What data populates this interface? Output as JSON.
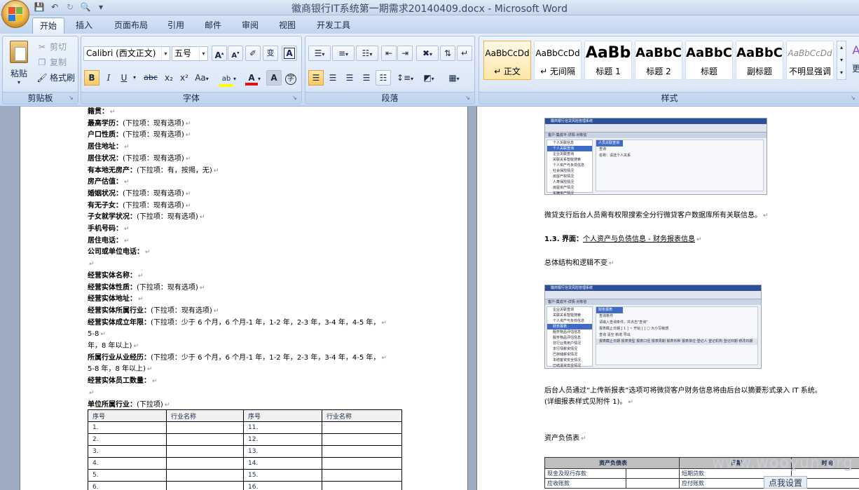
{
  "window": {
    "title": "徽商银行IT系统第一期需求20140409.docx - Microsoft Word"
  },
  "quick_access": [
    "save-icon",
    "undo-icon",
    "redo-icon",
    "print-preview-icon",
    "customize-icon"
  ],
  "tabs": [
    "开始",
    "插入",
    "页面布局",
    "引用",
    "邮件",
    "审阅",
    "视图",
    "开发工具"
  ],
  "ribbon": {
    "clipboard": {
      "label": "剪贴板",
      "paste": "粘贴",
      "cut": "剪切",
      "copy": "复制",
      "format_painter": "格式刷"
    },
    "font": {
      "label": "字体",
      "font_name": "Calibri (西文正文)",
      "font_size": "五号",
      "phonetic": "变",
      "buttons": [
        "B",
        "I",
        "U",
        "abc",
        "x₂",
        "x²",
        "Aa"
      ]
    },
    "paragraph": {
      "label": "段落"
    },
    "styles": {
      "label": "样式",
      "change_styles": "更",
      "items": [
        {
          "sample": "AaBbCcDd",
          "name": "↵ 正文"
        },
        {
          "sample": "AaBbCcDd",
          "name": "↵ 无间隔"
        },
        {
          "sample": "AaBb",
          "name": "标题 1"
        },
        {
          "sample": "AaBbC",
          "name": "标题 2"
        },
        {
          "sample": "AaBbC",
          "name": "标题"
        },
        {
          "sample": "AaBbC",
          "name": "副标题"
        },
        {
          "sample": "AaBbCcDd",
          "name": "不明显强调"
        }
      ]
    }
  },
  "left_page": {
    "lines": [
      {
        "bold": "籍贯：",
        "rest": ""
      },
      {
        "bold": "最高学历：",
        "rest": "(下拉项：现有选项)"
      },
      {
        "bold": "户口性质：",
        "rest": "(下拉项：现有选项)"
      },
      {
        "bold": "居住地址：",
        "rest": ""
      },
      {
        "bold": "居住状况：",
        "rest": "(下拉项：现有选项)"
      },
      {
        "bold": "有本地无房产：",
        "rest": "(下拉项：有，按揭，无)"
      },
      {
        "bold": "房产估值：",
        "rest": ""
      },
      {
        "bold": "婚姻状况：",
        "rest": "(下拉项：现有选项)"
      },
      {
        "bold": "有无子女：",
        "rest": "(下拉项：现有选项)"
      },
      {
        "bold": "子女就学状况：",
        "rest": "(下拉项：现有选项)"
      },
      {
        "bold": "手机号码：",
        "rest": ""
      },
      {
        "bold": "居住电话：",
        "rest": ""
      },
      {
        "bold": "公司或单位电话：",
        "rest": ""
      },
      {
        "bold": "",
        "rest": ""
      },
      {
        "bold": "经营实体名称：",
        "rest": ""
      },
      {
        "bold": "经营实体性质：",
        "rest": "(下拉项：现有选项)"
      },
      {
        "bold": "经营实体地址：",
        "rest": ""
      },
      {
        "bold": "经营实体所属行业：",
        "rest": "(下拉项：现有选项)"
      },
      {
        "bold": "经营实体成立年限：",
        "rest": "(下拉项：少于 6 个月，6 个月-1 年，1-2 年，2-3 年，3-4 年，4-5 年，"
      },
      {
        "bold": "",
        "rest": "5-8"
      },
      {
        "bold": "",
        "rest": "年，8 年以上)"
      },
      {
        "bold": "所属行业从业经历：",
        "rest": "(下拉项：少于 6 个月，6 个月-1 年，1-2 年，2-3 年，3-4 年，4-5 年，"
      },
      {
        "bold": "",
        "rest": "5-8 年，8 年以上)"
      },
      {
        "bold": "经营实体员工数量：",
        "rest": ""
      },
      {
        "bold": "",
        "rest": ""
      },
      {
        "bold": "单位所属行业：",
        "rest": "(下拉项)"
      }
    ],
    "table": {
      "headers": [
        "序号",
        "行业名称",
        "序号",
        "行业名称"
      ],
      "rows": [
        [
          "1.",
          "",
          "11.",
          ""
        ],
        [
          "2.",
          "",
          "12.",
          ""
        ],
        [
          "3.",
          "",
          "13.",
          ""
        ],
        [
          "4.",
          "",
          "14.",
          ""
        ],
        [
          "5.",
          "",
          "15.",
          ""
        ],
        [
          "6.",
          "",
          "16.",
          ""
        ]
      ]
    }
  },
  "right_page": {
    "screenshot1": {
      "title": "徽商银行信贷风险管理系统",
      "crumb": "客户-集成平-详情-对象信",
      "tree": [
        "个人关联信息",
        "个人关联查询",
        "企业关联查询",
        "关联关系智能搜索",
        "个人资产与负债信息",
        "社会保险情况",
        "房屋产权情况",
        "人寿保险情况",
        "房屋资产情况",
        "车辆资产情况"
      ],
      "main_head": "人员关联查询",
      "main_rows": [
        "查询",
        "名称：请选个人关系"
      ]
    },
    "para1": "微贷支行后台人员需有权限搜索全分行微贷客户数据库所有关联信息。",
    "heading": "1.3.  界面：",
    "heading_link": "个人资产与负债信息 - 财务报表信息",
    "para2": "总体结构和逻辑不变",
    "screenshot2": {
      "title": "徽商银行信贷风险管理系统",
      "crumb": "客户-集成平-详情-对象信",
      "tree": [
        "企业关联查询",
        "关联关系智能搜索",
        "个人资产与负债信息",
        "财务报表",
        "服务物品评估信息",
        "服务物品评估信息",
        "非行业类用户情况",
        "本行情薪资情况",
        "巴林储薪资情况",
        "本结客资安全情况",
        "已结退资安全情况",
        "已结退资安全情况"
      ],
      "main_head": "财务报表",
      "main_rows": [
        "查询条件",
        "请输入查询条件，并点击\"查询\"",
        "报表截止日期 [ 1 ] ~ 开始  [            ]  □ 大小写敏感",
        "查询  清空  新增  导出",
        "报表截止日期  报表类型  报表口径  报表周期  报表币种  报表单位  登记人  登记机构  登记日期  修改日期"
      ]
    },
    "para3": "后台人员通过“上传新报表”选项可将微贷客户财务信息将由后台以摘要形式录入 IT 系统。",
    "para3b": "(详细报表样式见附件 1)。",
    "para4": "资产负债表",
    "bs_table": {
      "title": "资产负债表",
      "date_label": "日期",
      "time_label": "时间",
      "row1_left": "现金及现行存款",
      "row1_right": "短期贷款",
      "row2_left": "应收账款",
      "row2_right": "应付账款"
    }
  },
  "watermark": "www.wooyun.org",
  "settings_button": "点我设置"
}
